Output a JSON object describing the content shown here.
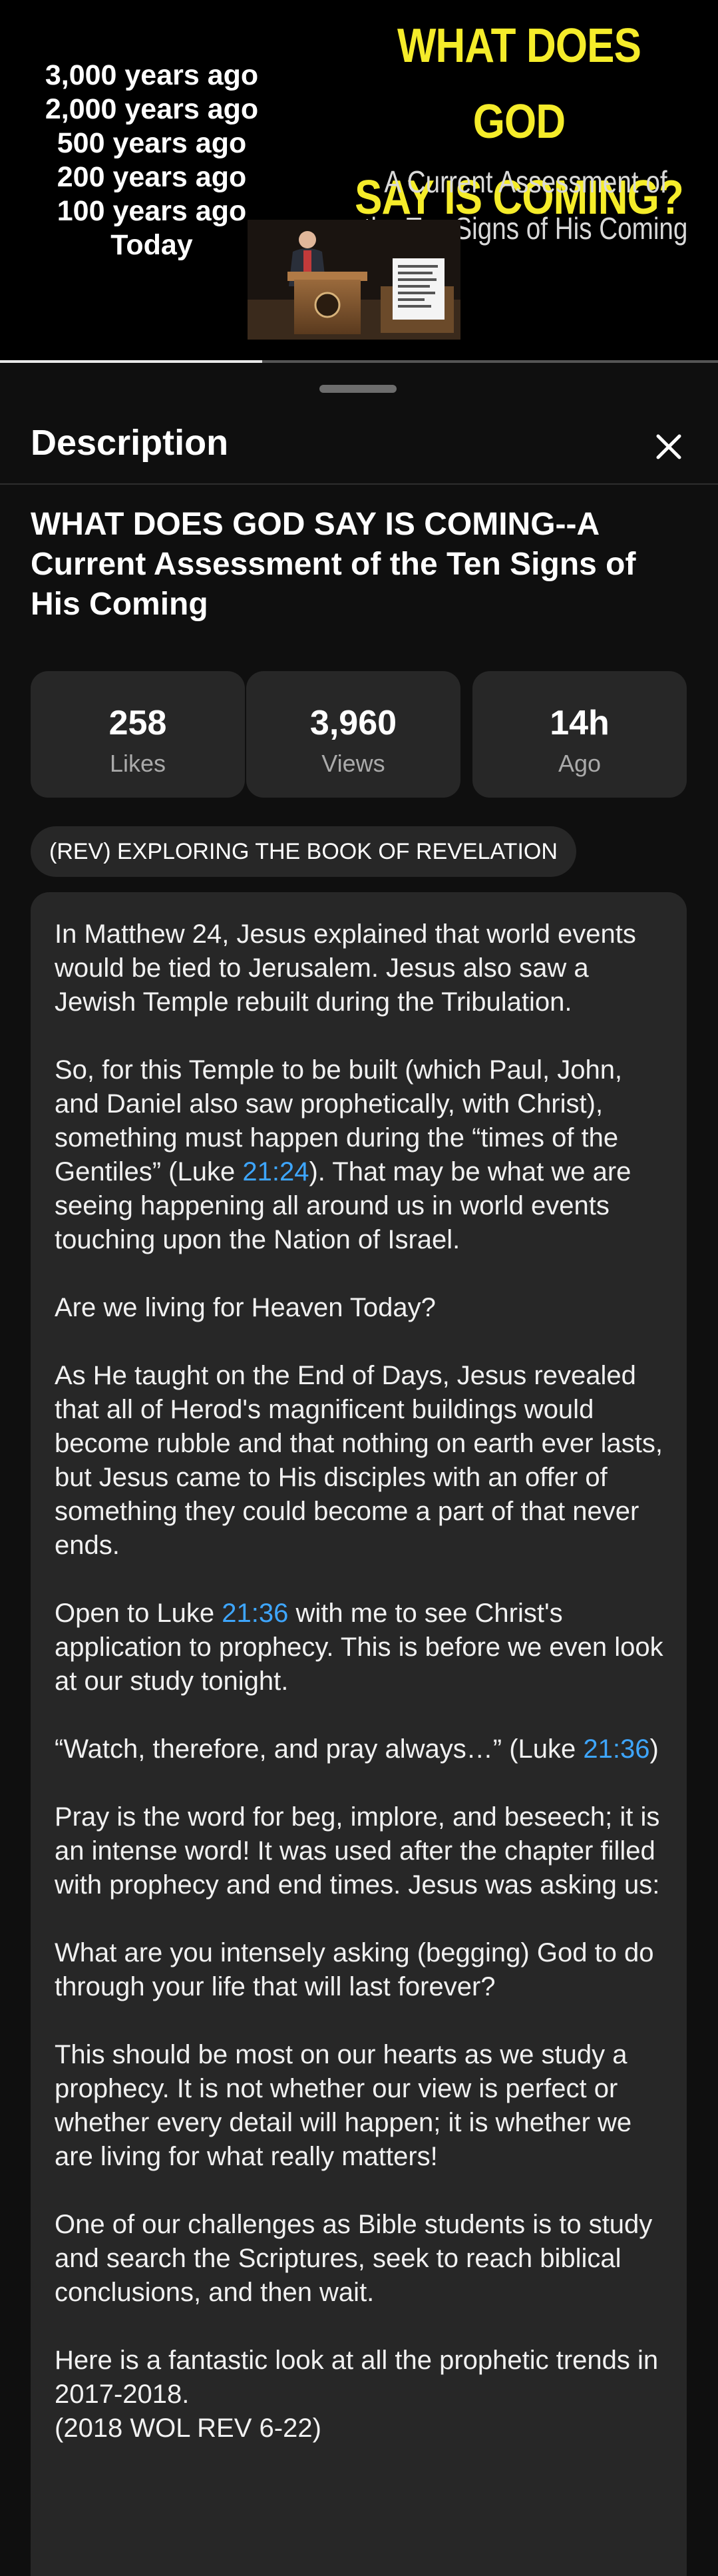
{
  "thumbnail": {
    "timeline": [
      "3,000 years ago",
      "2,000 years ago",
      "500 years ago",
      "200 years ago",
      "100 years ago",
      "Today"
    ],
    "title_line1": "WHAT DOES GOD",
    "title_line2": "SAY IS COMING?",
    "subtitle": "A Current Assessment of the Ten Signs of His Coming",
    "title_color": "#f5ec2a"
  },
  "player": {
    "progress_fraction": 0.365
  },
  "sheet": {
    "header_title": "Description",
    "close_icon": "close-icon"
  },
  "video": {
    "title": "WHAT DOES GOD SAY IS COMING--A Current Assessment of the Ten Signs of His Coming"
  },
  "stats": [
    {
      "value": "258",
      "label": "Likes"
    },
    {
      "value": "3,960",
      "label": "Views"
    },
    {
      "value": "14h",
      "label": "Ago"
    }
  ],
  "playlist_chip": "(REV) EXPLORING THE BOOK OF REVELATION",
  "description": {
    "p1": "In Matthew 24, Jesus explained that world events would be tied to Jerusalem. Jesus also saw a Jewish Temple rebuilt during the Tribulation.",
    "p2_before": "So, for this Temple to be built (which Paul, John, and Daniel also saw prophetically, with Christ), something must happen during the “times of the Gentiles” (Luke ",
    "p2_ts": "21:24",
    "p2_after": "). That may be what we are seeing happening all around us in world events touching upon the Nation of Israel.",
    "p3": "Are we living for Heaven Today?",
    "p4": "As He taught on the End of Days, Jesus revealed that all of Herod's magnificent buildings would become rubble and that nothing on earth ever lasts, but Jesus came to His disciples with an offer of something they could become a part of that never ends.",
    "p5_before": "Open to Luke ",
    "p5_ts": "21:36",
    "p5_after": " with me to see Christ's application to prophecy. This is before we even look at our study tonight.",
    "p6_before": "“Watch, therefore, and pray always…” (Luke ",
    "p6_ts": "21:36",
    "p6_after": ")",
    "p7": "Pray is the word for beg, implore, and beseech; it is an intense word! It was used after the chapter filled with prophecy and end times. Jesus was asking us:",
    "p8": "What are you intensely asking (begging) God to do through your life that will last forever?",
    "p9": "This should be most on our hearts as we study a prophecy. It is not whether our view is perfect or whether every detail will happen; it is whether we are living for what really matters!",
    "p10": "One of our challenges as Bible students is to study and search the Scriptures, seek to reach biblical conclusions, and then wait.",
    "p11": "Here is a fantastic look at all the prophetic trends in 2017-2018.",
    "p11_line2": "(2018 WOL REV 6-22)"
  },
  "colors": {
    "background": "#0f0f0f",
    "card": "#272727",
    "link": "#3ea6ff"
  }
}
